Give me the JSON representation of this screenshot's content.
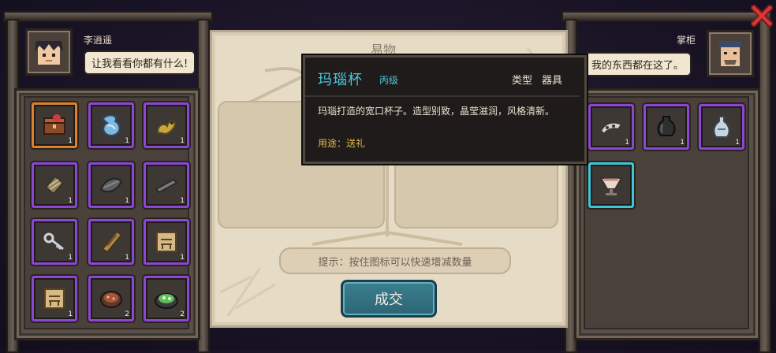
{
  "left_npc": {
    "name": "李逍遥",
    "speech": "让我看看你都有什么!"
  },
  "right_npc": {
    "name": "掌柜",
    "speech": "我的东西都在这了。"
  },
  "trade_panel": {
    "title": "易物",
    "hint": "提示：按住图标可以快速增减数量",
    "trade_button": "成交"
  },
  "tooltip": {
    "item_name": "玛瑙杯",
    "grade": "丙级",
    "type_label": "类型",
    "type_value": "器具",
    "description": "玛瑙打造的宽口杯子。造型别致，晶莹滋润，风格清新。",
    "usage": "用途：送礼"
  },
  "player_items": [
    {
      "icon": "treasure-chest-icon",
      "qty": "1",
      "border": "orange"
    },
    {
      "icon": "blue-vase-icon",
      "qty": "1",
      "border": "purple"
    },
    {
      "icon": "gold-dragon-icon",
      "qty": "1",
      "border": "purple"
    },
    {
      "icon": "wrapped-bundle-icon",
      "qty": "1",
      "border": "purple"
    },
    {
      "icon": "gray-leaf-icon",
      "qty": "1",
      "border": "purple"
    },
    {
      "icon": "metal-bar-icon",
      "qty": "1",
      "border": "purple"
    },
    {
      "icon": "silver-key-icon",
      "qty": "1",
      "border": "purple"
    },
    {
      "icon": "scroll-box-icon",
      "qty": "1",
      "border": "purple"
    },
    {
      "icon": "map-paper-icon",
      "qty": "1",
      "border": "purple"
    },
    {
      "icon": "map-paper-icon",
      "qty": "1",
      "border": "purple"
    },
    {
      "icon": "food-bowl-icon",
      "qty": "2",
      "border": "purple"
    },
    {
      "icon": "green-dish-icon",
      "qty": "2",
      "border": "purple"
    }
  ],
  "merchant_items": [
    {
      "icon": "bone-ornament-icon",
      "qty": "1",
      "border": "purple"
    },
    {
      "icon": "dark-jar-icon",
      "qty": "1",
      "border": "purple"
    },
    {
      "icon": "white-vase-icon",
      "qty": "1",
      "border": "purple"
    },
    {
      "icon": "agate-cup-icon",
      "qty": "",
      "border": "cyan"
    }
  ],
  "colors": {
    "rare_border": "#8a47d4",
    "legend_border": "#d9822b",
    "selected_border": "#3ec5d6",
    "title_cyan": "#48c9e0",
    "usage_gold": "#e2b84a"
  }
}
